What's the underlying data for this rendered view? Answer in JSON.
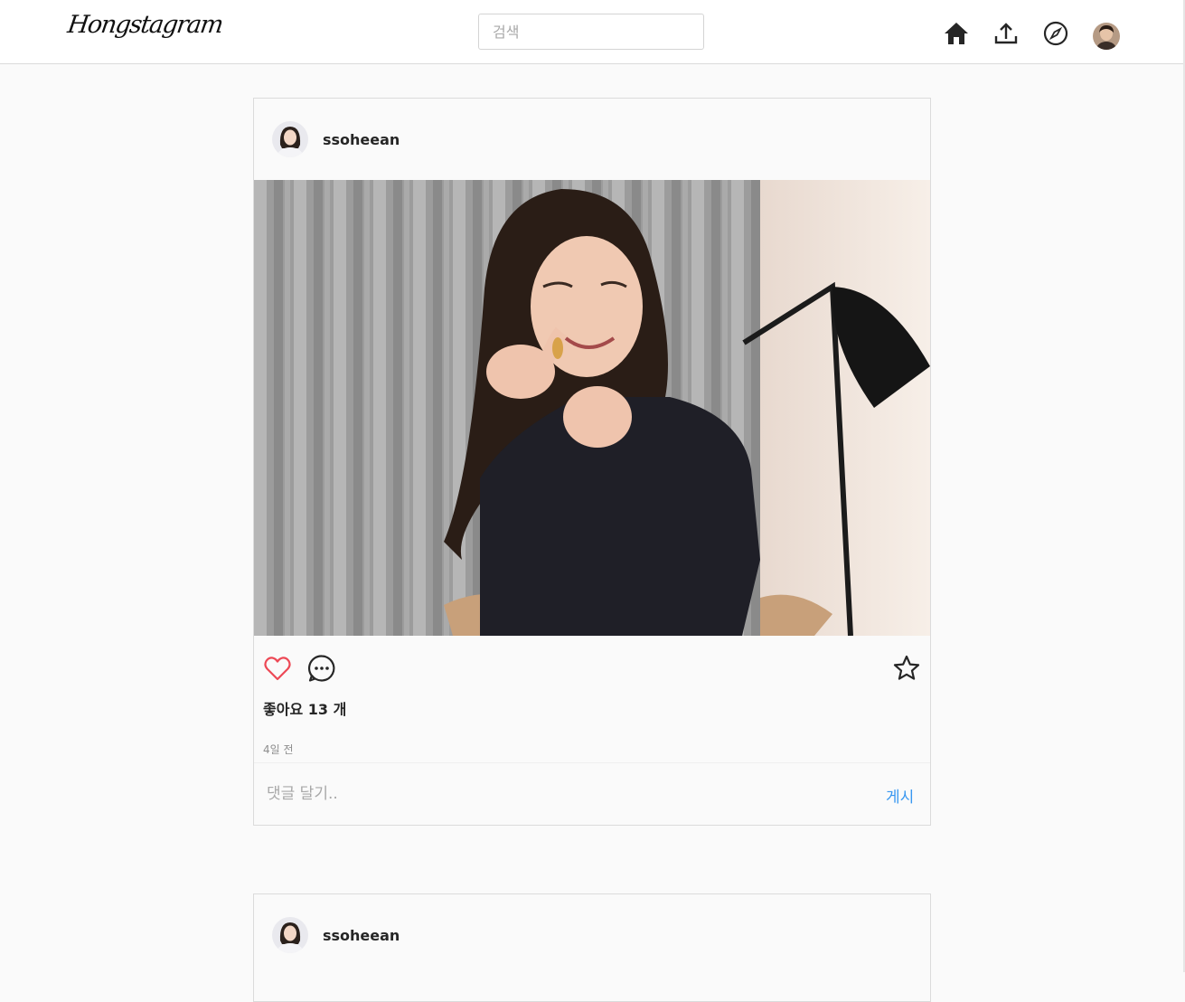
{
  "header": {
    "logo": "Hongstagram",
    "search_placeholder": "검색",
    "nav": [
      "home-icon",
      "upload-icon",
      "explore-compass-icon",
      "profile-avatar"
    ]
  },
  "posts": [
    {
      "username": "ssoheean",
      "likes_text": "좋아요 13 개",
      "time": "4일 전",
      "comment_placeholder": "댓글 달기..",
      "post_label": "게시",
      "liked": false
    },
    {
      "username": "ssoheean"
    }
  ],
  "colors": {
    "link": "#3897f0",
    "heart": "#ed4956",
    "border": "#dbdbdb",
    "background": "#fafafa"
  }
}
